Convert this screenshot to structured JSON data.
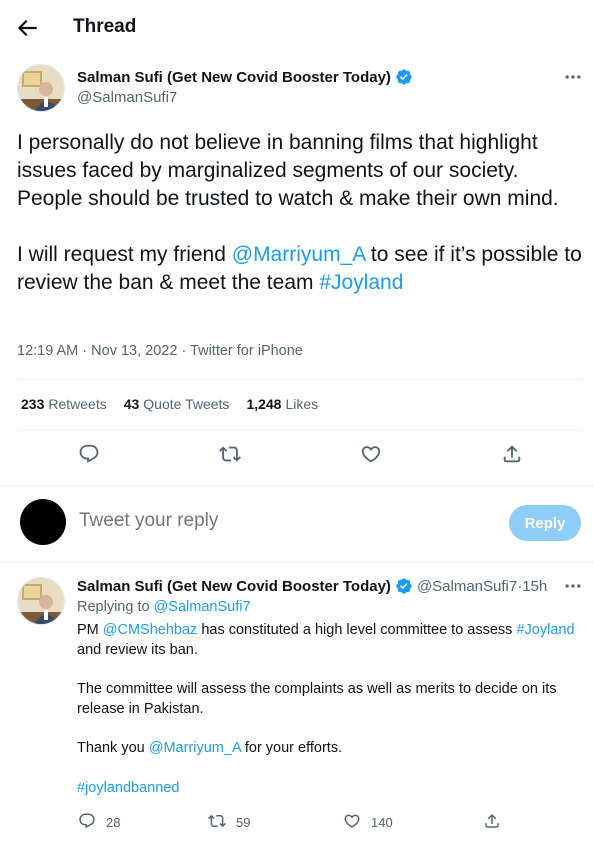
{
  "header": {
    "title": "Thread"
  },
  "main_tweet": {
    "author_name": "Salman Sufi (Get New Covid Booster Today)",
    "handle": "@SalmanSufi7",
    "text_line1": "I personally do not believe in banning films that highlight issues faced by marginalized segments of our society. People should be trusted to watch & make their own mind.",
    "text_line2_pre": "I will request my friend ",
    "mention": "@Marriyum_A",
    "text_line2_mid": " to see if it’s possible to review the ban & meet the team ",
    "hashtag": "#Joyland",
    "time": "12:19 AM",
    "separator": " · ",
    "date": "Nov 13, 2022",
    "source": "Twitter for iPhone",
    "stats": {
      "retweets_count": "233",
      "retweets_label": "Retweets",
      "quotes_count": "43",
      "quotes_label": "Quote Tweets",
      "likes_count": "1,248",
      "likes_label": "Likes"
    }
  },
  "composer": {
    "placeholder": "Tweet your reply",
    "button_label": "Reply"
  },
  "reply_tweet": {
    "author_name": "Salman Sufi (Get New Covid Booster Today)",
    "handle": "@SalmanSufi7",
    "separator": " · ",
    "time_ago": "15h",
    "replying_to_label": "Replying to ",
    "replying_to_handle": "@SalmanSufi7",
    "p1_pre": "PM ",
    "p1_mention": "@CMShehbaz",
    "p1_mid": " has constituted a high level committee to assess ",
    "p1_hashtag": "#Joyland",
    "p1_post": " and review its ban.",
    "p2": "The committee will assess the complaints as well as merits to decide on its release in Pakistan.",
    "p3_pre": "Thank you ",
    "p3_mention": "@Marriyum_A",
    "p3_post": " for your efforts.",
    "p4_hashtag": "#joylandbanned",
    "actions": {
      "reply_count": "28",
      "retweet_count": "59",
      "like_count": "140"
    }
  },
  "icons": {
    "back": "back-arrow-icon",
    "verified": "verified-badge-icon",
    "more": "more-icon",
    "reply": "reply-icon",
    "retweet": "retweet-icon",
    "like": "like-icon",
    "share": "share-icon"
  },
  "colors": {
    "accent": "#1d9bf0",
    "muted_text": "#536471",
    "reply_button_disabled": "#8ecdf7",
    "divider": "#eff3f4"
  }
}
